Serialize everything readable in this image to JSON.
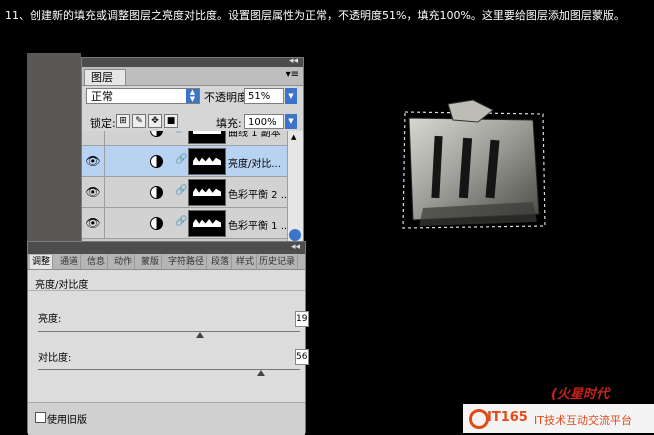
{
  "instruction": "11、创建新的填充或调整图层之亮度对比度。设置图层属性为正常，不透明度51%，填充100%。这里要给图层添加图层蒙版。",
  "layers_panel": {
    "tab_label": "图层",
    "blend_mode": "正常",
    "opacity_label": "不透明度:",
    "opacity_value": "51%",
    "lock_label": "锁定:",
    "fill_label": "填充:",
    "fill_value": "100%",
    "layers": [
      {
        "name": "曲线 1 副本",
        "visible": false,
        "selected": false
      },
      {
        "name": "亮度/对比...",
        "visible": true,
        "selected": true
      },
      {
        "name": "色彩平衡 2 ...",
        "visible": true,
        "selected": false
      },
      {
        "name": "色彩平衡 1 ...",
        "visible": true,
        "selected": false
      }
    ]
  },
  "adjustments_panel": {
    "tabs": [
      "调整",
      "通道",
      "信息",
      "动作",
      "蒙版",
      "字符",
      "路径",
      "段落",
      "样式",
      "历史记录"
    ],
    "active_tab": "调整",
    "title": "亮度/对比度",
    "brightness_label": "亮度:",
    "brightness_value": "19",
    "brightness_fraction": 0.62,
    "contrast_label": "对比度:",
    "contrast_value": "56",
    "contrast_fraction": 0.85,
    "legacy_label": "使用旧版"
  },
  "watermark": {
    "left_text": "(火星时代",
    "brand": "IT165",
    "tagline": "IT技术互动交流平台"
  }
}
